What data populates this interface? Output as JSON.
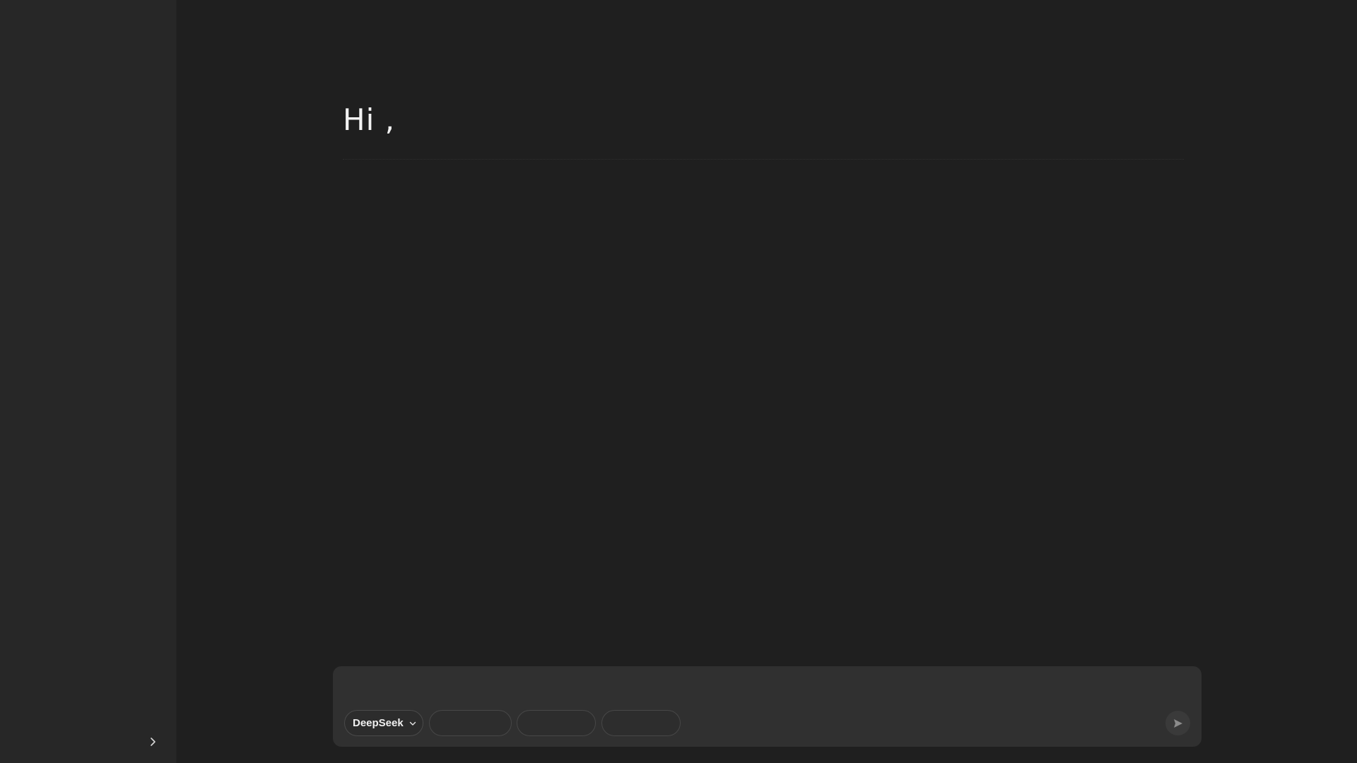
{
  "main": {
    "greeting": "Hi ,"
  },
  "composer": {
    "input_value": "",
    "input_placeholder": "",
    "model_selector": {
      "selected": "DeepSeek",
      "icon": "chevron-down-icon"
    },
    "chips": [
      {
        "label": ""
      },
      {
        "label": ""
      },
      {
        "label": ""
      }
    ],
    "send_icon": "send-icon"
  },
  "sidebar": {
    "toggle_icon": "chevron-right-icon"
  },
  "colors": {
    "background": "#1f1f1f",
    "sidebar": "#272727",
    "composer": "#303030",
    "text": "#f2f2f2"
  }
}
